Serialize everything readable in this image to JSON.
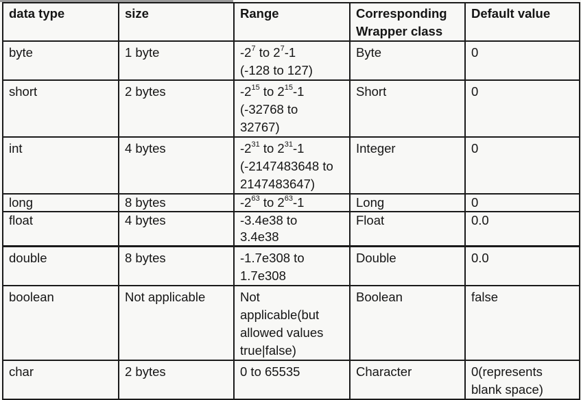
{
  "table": {
    "headers": [
      {
        "key": "data_type",
        "label": "data type"
      },
      {
        "key": "size",
        "label": "size"
      },
      {
        "key": "range",
        "label": "Range"
      },
      {
        "key": "wrapper",
        "label": "Corresponding\nWrapper class"
      },
      {
        "key": "default",
        "label": "Default value"
      }
    ],
    "rows": [
      {
        "data_type": "byte",
        "size": "1 byte",
        "range": {
          "expr": {
            "neg_base": "-2",
            "neg_exp": "7",
            "to": " to ",
            "pos_base": "2",
            "pos_exp": "7",
            "tail": "-1"
          },
          "text": "(-128 to 127)"
        },
        "wrapper": "Byte",
        "default": "0"
      },
      {
        "data_type": "short",
        "size": "2 bytes",
        "range": {
          "expr": {
            "neg_base": "-2",
            "neg_exp": "15",
            "to": " to ",
            "pos_base": "2",
            "pos_exp": "15",
            "tail": "-1"
          },
          "text": "(-32768 to\n32767)"
        },
        "wrapper": "Short",
        "default": "0"
      },
      {
        "data_type": "int",
        "size": "4 bytes",
        "range": {
          "expr": {
            "neg_base": "-2",
            "neg_exp": "31",
            "to": " to ",
            "pos_base": "2",
            "pos_exp": "31",
            "tail": "-1"
          },
          "text": "(-2147483648 to\n2147483647)"
        },
        "wrapper": "Integer",
        "default": "0"
      },
      {
        "data_type": "long",
        "size": "8 bytes",
        "range": {
          "expr": {
            "neg_base": "-2",
            "neg_exp": "63",
            "to": " to ",
            "pos_base": "2",
            "pos_exp": "63",
            "tail": "-1"
          },
          "text": ""
        },
        "wrapper": "Long",
        "default": "0"
      },
      {
        "data_type": "float",
        "size": "4 bytes",
        "range": {
          "text": "-3.4e38 to\n3.4e38"
        },
        "wrapper": "Float",
        "default": "0.0"
      },
      {
        "data_type": "double",
        "size": "8 bytes",
        "range": {
          "text": "-1.7e308 to\n1.7e308"
        },
        "wrapper": "Double",
        "default": "0.0"
      },
      {
        "data_type": "boolean",
        "size": "Not applicable",
        "range": {
          "text": "Not\napplicable(but\nallowed values\ntrue|false)"
        },
        "wrapper": "Boolean",
        "default": "false"
      },
      {
        "data_type": "char",
        "size": "2 bytes",
        "range": {
          "text": "0 to 65535"
        },
        "wrapper": "Character",
        "default": "0(represents\nblank space)"
      }
    ]
  }
}
